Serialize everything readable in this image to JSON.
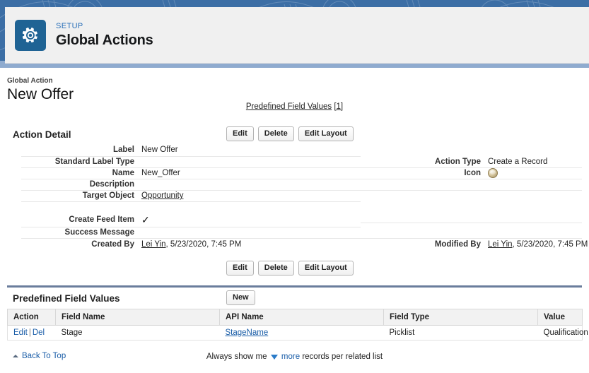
{
  "header": {
    "eyebrow": "SETUP",
    "title": "Global Actions",
    "gear_icon": "gear-icon"
  },
  "record": {
    "object_label": "Global Action",
    "title": "New Offer"
  },
  "related_links": {
    "label": "Predefined Field Values",
    "count": "[1]"
  },
  "action_detail": {
    "section_title": "Action Detail",
    "buttons_top": [
      "Edit",
      "Delete",
      "Edit Layout"
    ],
    "buttons_bottom": [
      "Edit",
      "Delete",
      "Edit Layout"
    ],
    "fields_left": [
      {
        "label": "Label",
        "value": "New Offer",
        "link": false
      },
      {
        "label": "Standard Label Type",
        "value": "",
        "link": false
      },
      {
        "label": "Name",
        "value": "New_Offer",
        "link": false
      },
      {
        "label": "Description",
        "value": "",
        "link": false
      },
      {
        "label": "Target Object",
        "value": "Opportunity",
        "link": true
      }
    ],
    "fields_right": [
      {
        "label": "Action Type",
        "value": "Create a Record",
        "link": false
      },
      {
        "label": "Icon",
        "value": "",
        "link": false,
        "icon": "record-icon-swatch"
      }
    ],
    "fields_left_lower": [
      {
        "label": "Create Feed Item",
        "value": "✓",
        "checkmark": true
      },
      {
        "label": "Success Message",
        "value": ""
      },
      {
        "label": "Created By",
        "value_link": "Lei Yin",
        "value_rest": ", 5/23/2020, 7:45 PM"
      }
    ],
    "fields_right_lower": [
      {
        "label": "Modified By",
        "value_link": "Lei Yin",
        "value_rest": ", 5/23/2020, 7:45 PM"
      }
    ]
  },
  "predefined_field_values": {
    "section_title": "Predefined Field Values",
    "new_button": "New",
    "columns": [
      "Action",
      "Field Name",
      "API Name",
      "Field Type",
      "Value"
    ],
    "rows": [
      {
        "action_edit": "Edit",
        "action_sep": "|",
        "action_del": "Del",
        "field_name": "Stage",
        "api_name": "StageName",
        "field_type": "Picklist",
        "value": "Qualification"
      }
    ]
  },
  "footer": {
    "back_to_top": "Back To Top",
    "always_prefix": "Always show me",
    "more_link": "more",
    "always_suffix": "records per related list"
  },
  "colors": {
    "banner_blue": "#3c6ea5",
    "setup_icon_blue": "#1f6394",
    "link_blue": "#1b5ea8",
    "eyebrow_blue": "#2a6fb8",
    "related_list_border": "#6a7d9c"
  }
}
